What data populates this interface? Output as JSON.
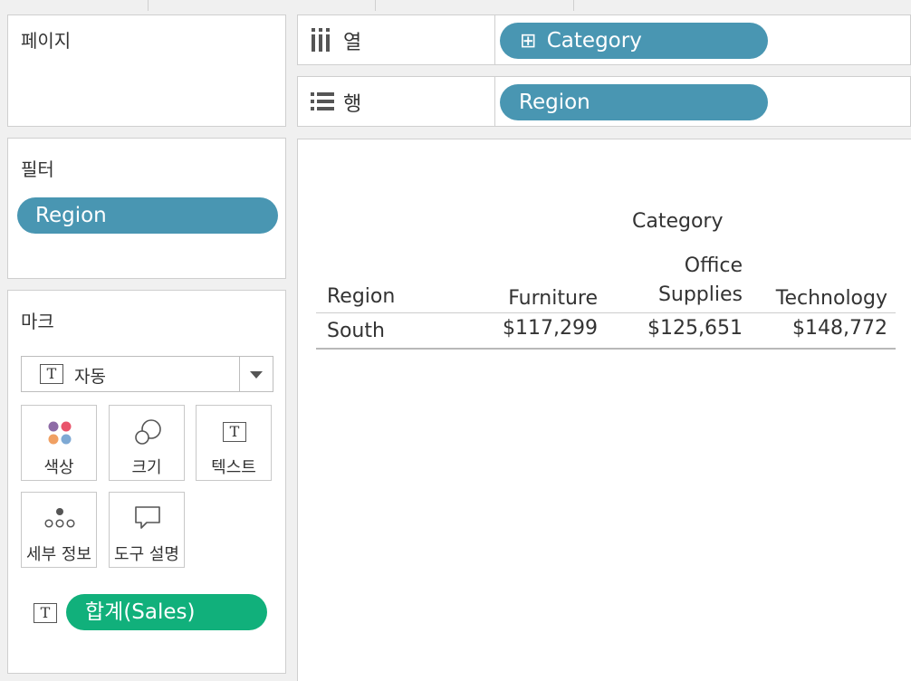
{
  "pages_panel": {
    "title": "페이지"
  },
  "shelves": {
    "columns": {
      "label": "열",
      "pill_prefix": "⊞",
      "pill": "Category"
    },
    "rows": {
      "label": "행",
      "pill": "Region"
    }
  },
  "filters_panel": {
    "title": "필터",
    "pill": "Region"
  },
  "marks_panel": {
    "title": "마크",
    "mark_type": {
      "icon_text": "T",
      "label": "자동"
    },
    "buttons": {
      "color": "색상",
      "size": "크기",
      "text": "텍스트",
      "detail": "세부 정보",
      "tooltip": "도구 설명"
    },
    "field": {
      "icon_text": "T",
      "pill": "합계(Sales)"
    }
  },
  "colors": {
    "pill_blue": "#4996b2",
    "pill_green": "#11b07b"
  },
  "table": {
    "column_group_header": "Category",
    "row_header": "Region",
    "columns": [
      {
        "line1": "",
        "line2": "Furniture"
      },
      {
        "line1": "Office",
        "line2": "Supplies"
      },
      {
        "line1": "",
        "line2": "Technology"
      }
    ],
    "rows": [
      {
        "label": "South",
        "values": [
          "$117,299",
          "$125,651",
          "$148,772"
        ]
      }
    ]
  }
}
